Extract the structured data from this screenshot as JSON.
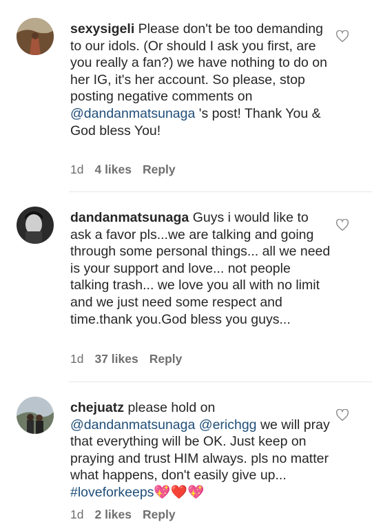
{
  "comments": [
    {
      "username": "sexysigeli",
      "text_parts": [
        {
          "t": " Please don't be too demanding to our idols. (Or should I ask you first, are you really a fan?) we have nothing to do on her IG, it's her account. So please, stop posting negative comments on "
        },
        {
          "mention": "@dandanmatsunaga"
        },
        {
          "t": " 's post! Thank You & God bless You!"
        }
      ],
      "time": "1d",
      "likes": "4 likes",
      "reply": "Reply"
    },
    {
      "username": "dandanmatsunaga",
      "text_parts": [
        {
          "t": " Guys i would like to ask a favor pls...we are talking and going through some personal things... all we need is your support and love... not people talking trash... we love you all with no limit and we just need some respect and time.thank you.God bless you guys..."
        }
      ],
      "time": "1d",
      "likes": "37 likes",
      "reply": "Reply"
    },
    {
      "username": "chejuatz",
      "text_parts": [
        {
          "t": " please hold on "
        },
        {
          "mention": "@dandanmatsunaga"
        },
        {
          "t": " "
        },
        {
          "mention": "@erichgg"
        },
        {
          "t": "  we will pray that everything will be OK. Just keep on praying and trust HIM always. pls no matter what happens, don't easily give up... "
        },
        {
          "tag": "#loveforkeeps"
        },
        {
          "emoji": "💖❤️💖"
        }
      ],
      "time": "1d",
      "likes": "2 likes",
      "reply": "Reply"
    }
  ],
  "icons": {
    "like": "heart-outline-icon"
  },
  "colors": {
    "mention": "#1f4e79",
    "meta": "#6f6f6f",
    "divider": "#e6e6e6"
  }
}
